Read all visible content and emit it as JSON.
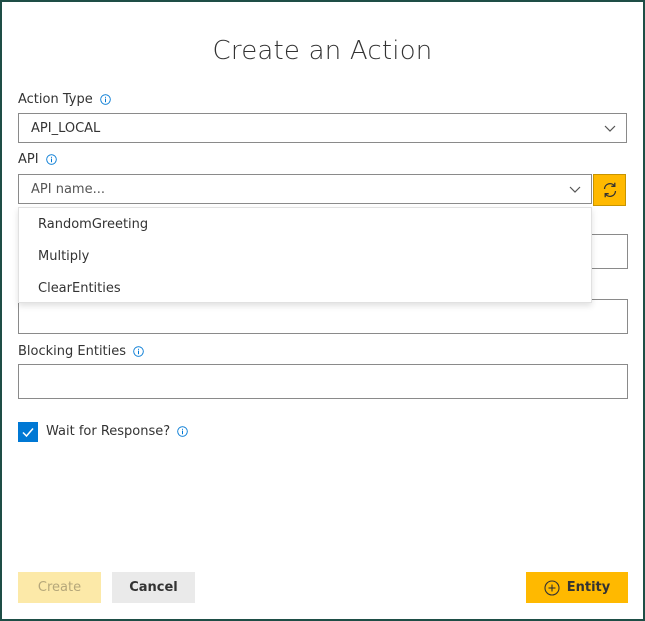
{
  "dialog": {
    "title": "Create an Action"
  },
  "action_type": {
    "label": "Action Type",
    "value": "API_LOCAL"
  },
  "api": {
    "label": "API",
    "placeholder": "API name...",
    "options": [
      "RandomGreeting",
      "Multiply",
      "ClearEntities"
    ]
  },
  "blocking_entities": {
    "label": "Blocking Entities"
  },
  "wait_for_response": {
    "label": "Wait for Response?",
    "checked": true
  },
  "footer": {
    "create_label": "Create",
    "cancel_label": "Cancel",
    "entity_label": "Entity"
  },
  "colors": {
    "accent": "#ffb900",
    "primary": "#0078d4",
    "border": "#1e4e46"
  }
}
